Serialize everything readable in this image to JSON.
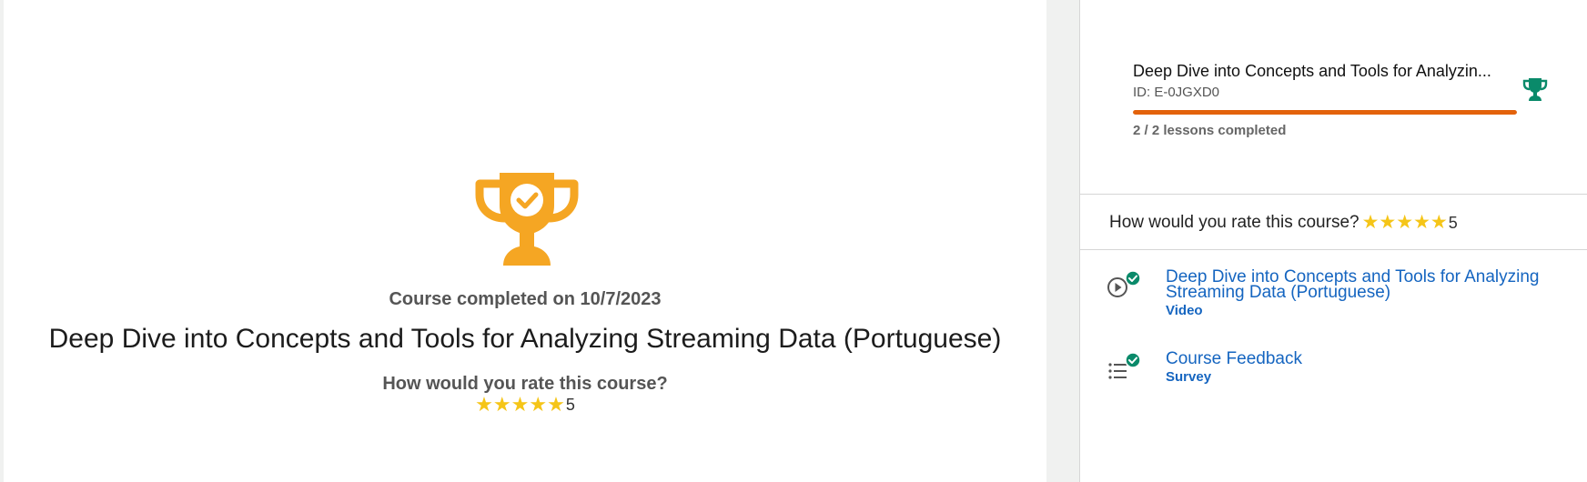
{
  "main": {
    "completed_text": "Course completed on 10/7/2023",
    "course_title": "Deep Dive into Concepts and Tools for Analyzing Streaming Data (Portuguese)",
    "rate_question": "How would you rate this course?",
    "rating_value": "5",
    "rating_stars": 5,
    "trophy_icon": "trophy-check-icon",
    "trophy_color": "#f5a623"
  },
  "sidebar": {
    "card": {
      "title": "Deep Dive into Concepts and Tools for Analyzin...",
      "id_text": "ID: E-0JGXD0",
      "progress_fraction": 1.0,
      "lessons_text": "2 / 2 lessons completed",
      "trophy_icon": "trophy-icon",
      "trophy_color": "#0a8a6a",
      "progress_color": "#e3620b"
    },
    "rating": {
      "question": "How would you rate this course?",
      "value": "5",
      "stars": 5
    },
    "lessons": [
      {
        "title": "Deep Dive into Concepts and Tools for Analyzing Streaming Data (Portuguese)",
        "type": "Video",
        "icon": "play-circle-icon",
        "status_icon": "check-circle-icon"
      },
      {
        "title": "Course Feedback",
        "type": "Survey",
        "icon": "list-icon",
        "status_icon": "check-circle-icon"
      }
    ]
  },
  "colors": {
    "link": "#1565c0",
    "star": "#f5c518",
    "check": "#0a8a6a"
  }
}
